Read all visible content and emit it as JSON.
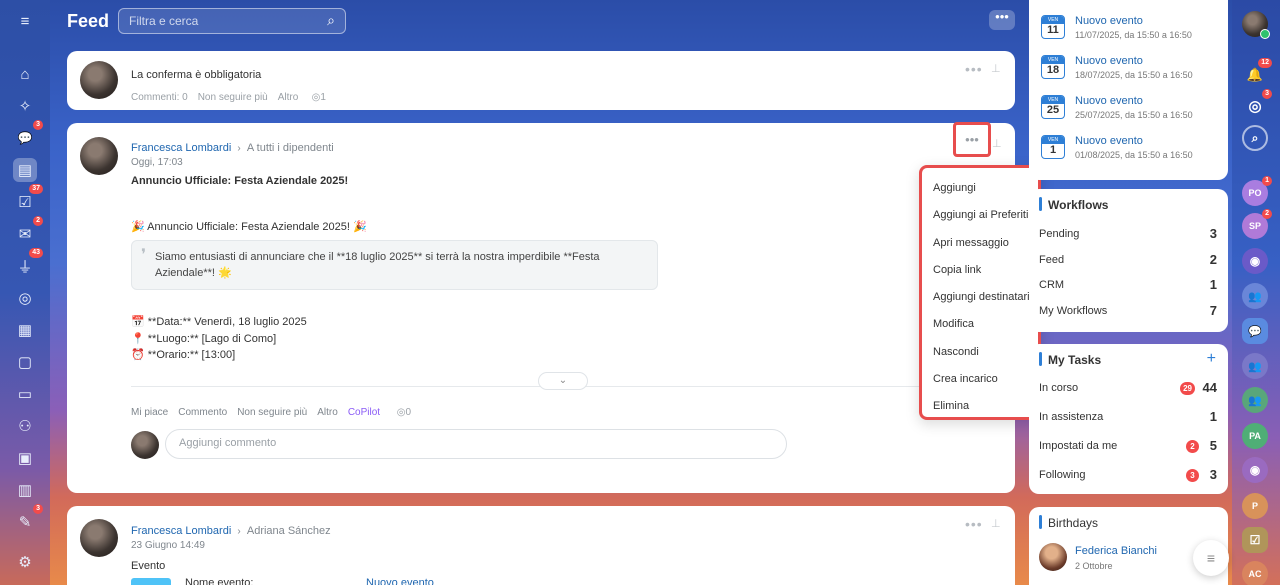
{
  "header": {
    "title": "Feed",
    "search_placeholder": "Filtra e cerca",
    "more": "•••"
  },
  "left_sidebar": {
    "items": [
      {
        "icon": "menu-icon",
        "glyph": "≡"
      },
      {
        "icon": "home-icon",
        "glyph": "⌂"
      },
      {
        "icon": "copilot-icon",
        "glyph": "✧"
      },
      {
        "icon": "chat-icon",
        "glyph": "💬",
        "badge": "3"
      },
      {
        "icon": "feed-icon",
        "glyph": "▤"
      },
      {
        "icon": "tasks-icon",
        "glyph": "☑",
        "badge": "37"
      },
      {
        "icon": "mail-icon",
        "glyph": "✉",
        "badge": "2"
      },
      {
        "icon": "funnel-icon",
        "glyph": "⏚",
        "badge": "43"
      },
      {
        "icon": "target-icon",
        "glyph": "◎"
      },
      {
        "icon": "calendar-icon",
        "glyph": "▦"
      },
      {
        "icon": "document-icon",
        "glyph": "▢"
      },
      {
        "icon": "storage-icon",
        "glyph": "▭"
      },
      {
        "icon": "people-icon",
        "glyph": "⚇"
      },
      {
        "icon": "booking-icon",
        "glyph": "▣"
      },
      {
        "icon": "schedule-icon",
        "glyph": "▥"
      },
      {
        "icon": "edit-icon",
        "glyph": "✎",
        "badge": "3"
      },
      {
        "icon": "settings-icon",
        "glyph": "⚙"
      }
    ]
  },
  "post_pinned": {
    "title": "La conferma è obbligatoria",
    "comments": "Commenti: 0",
    "unfollow": "Non seguire più",
    "more": "Altro",
    "views": "1"
  },
  "post_main": {
    "author": "Francesca Lombardi",
    "recipients": "A tutti i dipendenti",
    "time": "Oggi, 17:03",
    "headline": "Annuncio Ufficiale: Festa Aziendale 2025!",
    "announce": "🎉 Annuncio Ufficiale: Festa Aziendale 2025! 🎉",
    "quote": "Siamo entusiasti di annunciare che il **18 luglio 2025** si terrà la nostra imperdibile **Festa Aziendale**! 🌟",
    "date_line": "📅 **Data:** Venerdì, 18 luglio 2025",
    "place_line": "📍 **Luogo:** [Lago di Como]",
    "time_line": "⏰ **Orario:** [13:00]",
    "actions": {
      "like": "Mi piace",
      "comment": "Commento",
      "unfollow": "Non seguire più",
      "more": "Altro",
      "copilot": "CoPilot",
      "views": "0"
    },
    "comment_placeholder": "Aggiungi commento"
  },
  "context_menu": {
    "items": [
      "Aggiungi",
      "Aggiungi ai Preferiti",
      "Apri messaggio",
      "Copia link",
      "Aggiungi destinatari",
      "Modifica",
      "Nascondi",
      "Crea incarico",
      "Elimina"
    ]
  },
  "post_second": {
    "author": "Francesca Lombardi",
    "recipients": "Adriana Sánchez",
    "time": "23 Giugno 14:49",
    "type": "Evento",
    "event_label": "Nome evento:",
    "event_value": "Nuovo evento"
  },
  "events": [
    {
      "weekday": "VEN",
      "day": "11",
      "title": "Nuovo evento",
      "when": "11/07/2025, da 15:50 a 16:50"
    },
    {
      "weekday": "VEN",
      "day": "18",
      "title": "Nuovo evento",
      "when": "18/07/2025, da 15:50 a 16:50"
    },
    {
      "weekday": "VEN",
      "day": "25",
      "title": "Nuovo evento",
      "when": "25/07/2025, da 15:50 a 16:50"
    },
    {
      "weekday": "VEN",
      "day": "1",
      "title": "Nuovo evento",
      "when": "01/08/2025, da 15:50 a 16:50"
    }
  ],
  "workflows": {
    "title": "Workflows",
    "rows": [
      {
        "label": "Pending",
        "value": "3"
      },
      {
        "label": "Feed",
        "value": "2"
      },
      {
        "label": "CRM",
        "value": "1"
      },
      {
        "label": "My Workflows",
        "value": "7"
      }
    ]
  },
  "my_tasks": {
    "title": "My Tasks",
    "plus": "+",
    "rows": [
      {
        "label": "In corso",
        "badge": "29",
        "value": "44"
      },
      {
        "label": "In assistenza",
        "badge": "",
        "value": "1"
      },
      {
        "label": "Impostati da me",
        "badge": "2",
        "value": "5"
      },
      {
        "label": "Following",
        "badge": "3",
        "value": "3"
      }
    ]
  },
  "birthdays": {
    "title": "Birthdays",
    "name": "Federica Bianchi",
    "date": "2 Ottobre"
  },
  "right_bar": {
    "items": [
      {
        "icon": "user-avatar-icon",
        "label": ""
      },
      {
        "icon": "bell-icon",
        "label": "🔔",
        "badge": "12"
      },
      {
        "icon": "copilot-ring-icon",
        "label": "◎",
        "badge": "3"
      },
      {
        "icon": "chat-search-icon",
        "label": "⌕"
      },
      {
        "icon": "group-avatar-po",
        "label": "PO",
        "badge": "1"
      },
      {
        "icon": "group-avatar-sp",
        "label": "SP",
        "badge": "2"
      },
      {
        "icon": "channel-icon",
        "label": "◉"
      },
      {
        "icon": "people-icon",
        "label": "👥"
      },
      {
        "icon": "chat-icon",
        "label": "💬"
      },
      {
        "icon": "people-icon",
        "label": "👥"
      },
      {
        "icon": "people-icon",
        "label": "👥"
      },
      {
        "icon": "group-avatar-pa",
        "label": "PA"
      },
      {
        "icon": "channel-icon",
        "label": "◉"
      },
      {
        "icon": "group-avatar-p",
        "label": "P"
      },
      {
        "icon": "task-icon",
        "label": "☑"
      },
      {
        "icon": "group-avatar-ac",
        "label": "AC"
      }
    ]
  },
  "fab": "≡"
}
